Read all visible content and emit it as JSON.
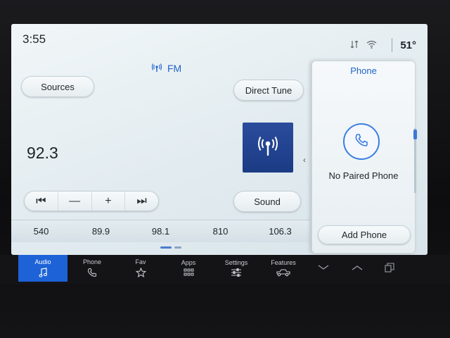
{
  "status": {
    "time": "3:55",
    "temperature": "51°"
  },
  "audio": {
    "source": "FM",
    "frequency": "92.3",
    "sources_label": "Sources",
    "direct_tune_label": "Direct Tune",
    "sound_label": "Sound",
    "controls": [
      {
        "name": "seek-back-button",
        "glyph": "⏮"
      },
      {
        "name": "tune-down-button",
        "glyph": "—"
      },
      {
        "name": "tune-up-button",
        "glyph": "+"
      },
      {
        "name": "seek-forward-button",
        "glyph": "⏭"
      }
    ],
    "presets": [
      "540",
      "89.9",
      "98.1",
      "810",
      "106.3"
    ]
  },
  "phone_panel": {
    "title": "Phone",
    "status": "No Paired Phone",
    "add_label": "Add Phone"
  },
  "nav": [
    {
      "label": "Audio",
      "icon": "music-note-icon",
      "active": true
    },
    {
      "label": "Phone",
      "icon": "phone-icon",
      "active": false
    },
    {
      "label": "Fav",
      "icon": "star-icon",
      "active": false
    },
    {
      "label": "Apps",
      "icon": "apps-grid-icon",
      "active": false
    },
    {
      "label": "Settings",
      "icon": "sliders-icon",
      "active": false
    },
    {
      "label": "Features",
      "icon": "truck-icon",
      "active": false
    }
  ],
  "colors": {
    "accent": "#1f63c9",
    "nav_active": "#1d62d6",
    "tile": "#1b3b84"
  }
}
